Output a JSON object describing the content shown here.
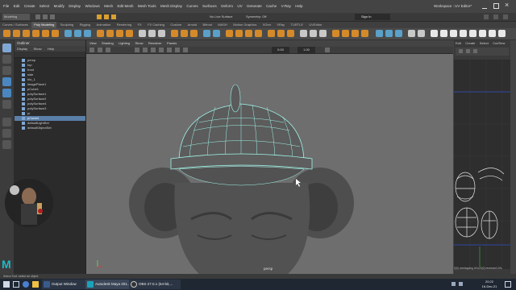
{
  "menubar": {
    "items": [
      "File",
      "Edit",
      "Create",
      "Select",
      "Modify",
      "Display",
      "Windows",
      "Mesh",
      "Edit Mesh",
      "Mesh Tools",
      "Mesh Display",
      "Curves",
      "Surfaces",
      "Deform",
      "UV",
      "Generate",
      "Cache",
      "V-Ray",
      "Help"
    ],
    "workspace": "Workspace : UV Editor*"
  },
  "statusline": {
    "mode": "Modeling",
    "no_live_surface": "No Live Surface",
    "symmetry": "Symmetry: Off",
    "sign_in": "Sign In"
  },
  "shelf": {
    "tabs": [
      "Curves / Surfaces",
      "Poly Modeling",
      "Sculpting",
      "Rigging",
      "Animation",
      "Rendering",
      "FX",
      "FX Caching",
      "Custom",
      "Arnold",
      "Bifrost",
      "MASH",
      "Motion Graphics",
      "XGen",
      "VRay",
      "TURTLE",
      "UVEditor"
    ],
    "active_tab": "Poly Modeling"
  },
  "outliner": {
    "title": "Outliner",
    "menu": [
      "Display",
      "Show",
      "Help"
    ],
    "items": [
      {
        "label": "persp",
        "selected": false
      },
      {
        "label": "top",
        "selected": false
      },
      {
        "label": "front",
        "selected": false
      },
      {
        "label": "side",
        "selected": false
      },
      {
        "label": "hlo_1",
        "selected": false
      },
      {
        "label": "imagePlane1",
        "selected": false
      },
      {
        "label": "pCube1",
        "selected": false
      },
      {
        "label": "polySurface1",
        "selected": false
      },
      {
        "label": "polySurface2",
        "selected": false
      },
      {
        "label": "polySurface4",
        "selected": false
      },
      {
        "label": "polySurface3",
        "selected": false
      },
      {
        "label": "pr",
        "selected": false
      },
      {
        "label": "pCube4",
        "selected": true
      },
      {
        "label": "defaultLightSet",
        "selected": false
      },
      {
        "label": "defaultObjectSet",
        "selected": false
      }
    ]
  },
  "panel": {
    "menu": [
      "View",
      "Shading",
      "Lighting",
      "Show",
      "Renderer",
      "Panels"
    ],
    "value_a": "0.00",
    "value_b": "1.00",
    "camera_label": "persp"
  },
  "uv_editor": {
    "menu": [
      "Edit",
      "Create",
      "Select",
      "Cut/Sew"
    ],
    "status": "0(0) overlapping UVs, 0(0) reversed UVs"
  },
  "helpline": {
    "text": "Select Tool: select an object"
  },
  "taskbar": {
    "items": [
      {
        "label": "Output Window",
        "color": "#3a5a8a"
      },
      {
        "label": "Autodesk Maya 201...",
        "color": "#1aa3b8"
      },
      {
        "label": "OBS 27.0.1 (64-bit,...",
        "color": "#333333"
      }
    ],
    "time": "20:22",
    "date": "16-Dec-21"
  },
  "accent": "#22b8c7",
  "selection_color": "#5a7fa8",
  "wireframe_color": "#9ff5e8"
}
